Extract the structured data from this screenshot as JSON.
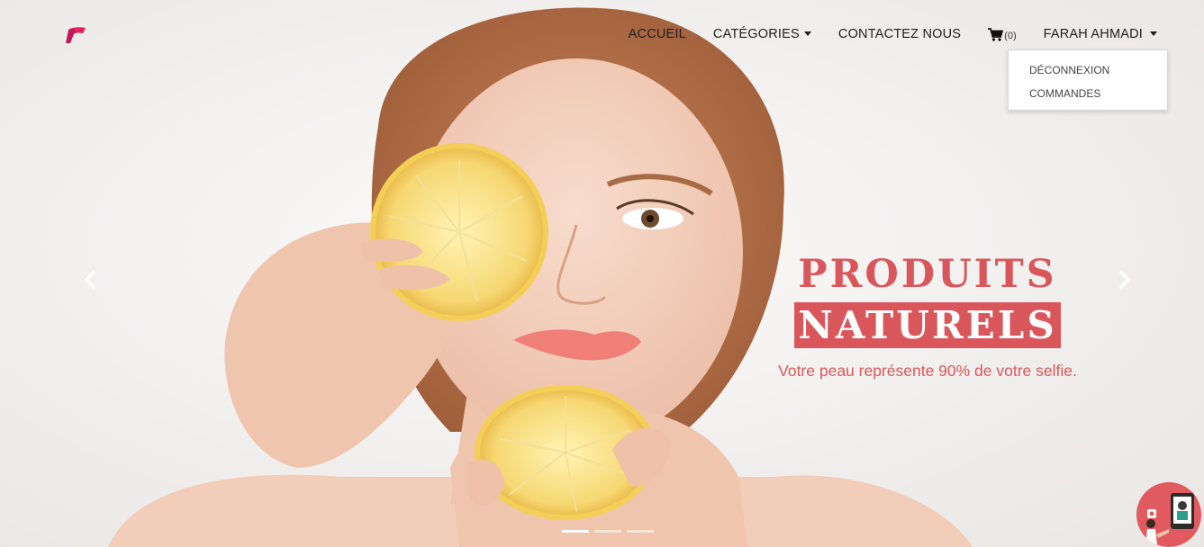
{
  "nav": {
    "links": [
      "ACCUEIL",
      "CATÉGORIES",
      "CONTACTEZ NOUS"
    ],
    "cart_count": "(0)",
    "user": "FARAH AHMADI"
  },
  "user_menu": {
    "items": [
      "DÉCONNEXION",
      "COMMANDES"
    ]
  },
  "hero": {
    "title_line1": "PRODUITS",
    "title_line2": "NATURELS",
    "tagline": "Votre peau représente 90% de votre selfie."
  },
  "carousel": {
    "slides": 3,
    "active_index": 0
  },
  "colors": {
    "accent": "#d9575b",
    "nav_text": "#1e1e1e"
  },
  "icons": {
    "logo": "brand-logo",
    "cart": "shopping-cart-icon",
    "prev": "chevron-left-icon",
    "next": "chevron-right-icon",
    "chat": "chat-support-icon"
  }
}
